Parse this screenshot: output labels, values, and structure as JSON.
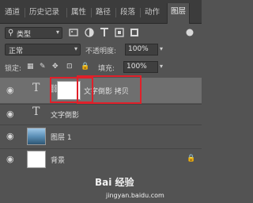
{
  "tabs": [
    {
      "label": "通道"
    },
    {
      "label": "历史记录"
    },
    {
      "label": "属性"
    },
    {
      "label": "路径"
    },
    {
      "label": "段落"
    },
    {
      "label": "动作"
    },
    {
      "label": "图层"
    }
  ],
  "filter": {
    "kind_label": "类型",
    "icons": [
      "image-filter-icon",
      "adjustment-filter-icon",
      "type-filter-icon",
      "shape-filter-icon",
      "smart-object-filter-icon"
    ]
  },
  "blend": {
    "mode": "正常",
    "opacity_label": "不透明度:",
    "opacity_value": "100%"
  },
  "lock": {
    "label": "锁定:",
    "fill_label": "填充:",
    "fill_value": "100%"
  },
  "layers": [
    {
      "name": "文字倒影 拷贝",
      "type": "text-with-mask"
    },
    {
      "name": "文字倒影",
      "type": "text"
    },
    {
      "name": "图层 1",
      "type": "image"
    },
    {
      "name": "背景",
      "type": "background"
    }
  ],
  "watermark": {
    "logo": "Bai 经验",
    "url": "jingyan.baidu.com"
  },
  "colors": {
    "panel_bg": "#535353",
    "tabbar_bg": "#3c3c3c",
    "selected_row": "#6f6f6f",
    "highlight": "#e0202a"
  }
}
